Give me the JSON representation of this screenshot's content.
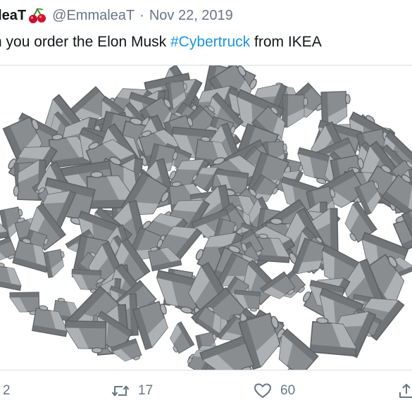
{
  "tweet": {
    "display_name": "aleaT",
    "handle": "@EmmaleaT",
    "separator": "·",
    "date": "Nov 22, 2019",
    "text_lead": "n you order the Elon Musk ",
    "hashtag": "#Cybertruck",
    "text_tail": " from IKEA"
  },
  "media": {
    "alt_subject": "pile-of-gray-sloped-bricks",
    "brick_color": "#8a8d90",
    "brick_shade": "#5f6265",
    "brick_light": "#aeb1b4",
    "background": "#ffffff"
  },
  "actions": {
    "reply_count": "2",
    "retweet_count": "17",
    "like_count": "60"
  },
  "icons": [
    "cherry-icon",
    "reply-icon",
    "retweet-icon",
    "like-icon",
    "share-icon"
  ],
  "colors": {
    "text": "#14171a",
    "muted": "#657786",
    "link": "#1b95e0"
  }
}
